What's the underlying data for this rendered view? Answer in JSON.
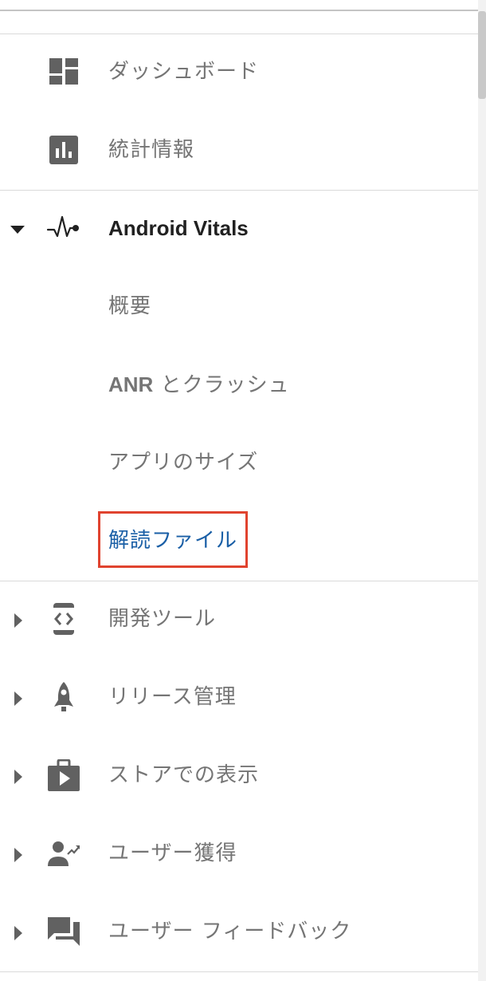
{
  "nav": {
    "dashboard": {
      "label": "ダッシュボード",
      "icon": "dashboard-icon"
    },
    "statistics": {
      "label": "統計情報",
      "icon": "bar-chart-icon"
    },
    "android_vitals": {
      "label": "Android Vitals",
      "icon": "vitals-pulse-icon",
      "expanded": true,
      "children": [
        {
          "label": "概要"
        },
        {
          "label_prefix": "ANR",
          "label_suffix": " とクラッシュ"
        },
        {
          "label": "アプリのサイズ"
        },
        {
          "label": "解読ファイル",
          "selected": true
        }
      ]
    },
    "dev_tools": {
      "label": "開発ツール",
      "icon": "code-icon"
    },
    "release": {
      "label": "リリース管理",
      "icon": "rocket-icon"
    },
    "store": {
      "label": "ストアでの表示",
      "icon": "play-store-icon"
    },
    "acquisition": {
      "label": "ユーザー獲得",
      "icon": "user-growth-icon"
    },
    "feedback": {
      "label": "ユーザー フィードバック",
      "icon": "chat-icon"
    }
  },
  "colors": {
    "text": "#757575",
    "heading": "#212121",
    "active": "#1a5fa6",
    "icon": "#616161",
    "highlight_border": "#e0432f"
  }
}
